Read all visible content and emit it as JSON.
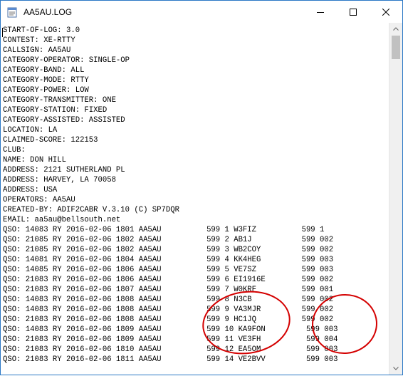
{
  "window": {
    "title": "AA5AU.LOG",
    "icon": "notepad-icon",
    "controls": [
      "minimize-icon",
      "maximize-icon",
      "close-icon"
    ]
  },
  "log_lines": [
    "START-OF-LOG: 3.0",
    "CONTEST: XE-RTTY",
    "CALLSIGN: AA5AU",
    "CATEGORY-OPERATOR: SINGLE-OP",
    "CATEGORY-BAND: ALL",
    "CATEGORY-MODE: RTTY",
    "CATEGORY-POWER: LOW",
    "CATEGORY-TRANSMITTER: ONE",
    "CATEGORY-STATION: FIXED",
    "CATEGORY-ASSISTED: ASSISTED",
    "LOCATION: LA",
    "CLAIMED-SCORE: 122153",
    "CLUB:",
    "NAME: DON HILL",
    "ADDRESS: 2121 SUTHERLAND PL",
    "ADDRESS: HARVEY, LA 70058",
    "ADDRESS: USA",
    "OPERATORS: AA5AU",
    "CREATED-BY: ADIF2CABR V.3.10 (C) SP7DQR",
    "EMAIL: aa5au@bellsouth.net",
    "QSO: 14083 RY 2016-02-06 1801 AA5AU          599 1 W3FIZ          599 1",
    "QSO: 21085 RY 2016-02-06 1802 AA5AU          599 2 AB1J           599 002",
    "QSO: 21085 RY 2016-02-06 1802 AA5AU          599 3 WB2COY         599 002",
    "QSO: 14081 RY 2016-02-06 1804 AA5AU          599 4 KK4HEG         599 003",
    "QSO: 14085 RY 2016-02-06 1806 AA5AU          599 5 VE7SZ          599 003",
    "QSO: 21083 RY 2016-02-06 1806 AA5AU          599 6 EI1916E        599 002",
    "QSO: 21083 RY 2016-02-06 1807 AA5AU          599 7 W0KRF          599 001",
    "QSO: 14083 RY 2016-02-06 1808 AA5AU          599 8 N3CB           599 002",
    "QSO: 14083 RY 2016-02-06 1808 AA5AU          599 9 VA3MJR         599 002",
    "QSO: 21083 RY 2016-02-06 1808 AA5AU          599 9 HC1JQ          599 002",
    "QSO: 14083 RY 2016-02-06 1809 AA5AU          599 10 KA9FON         599 003",
    "QSO: 21083 RY 2016-02-06 1809 AA5AU          599 11 VE3FH          599 004",
    "QSO: 21083 RY 2016-02-06 1810 AA5AU          599 12 EA5OM          599 003",
    "QSO: 21083 RY 2016-02-06 1811 AA5AU          599 14 VE2BVV         599 003"
  ],
  "annotation_color": "#d40000",
  "scrollbar": {
    "up_icon": "scroll-up-arrow-icon",
    "down_icon": "scroll-down-arrow-icon"
  }
}
